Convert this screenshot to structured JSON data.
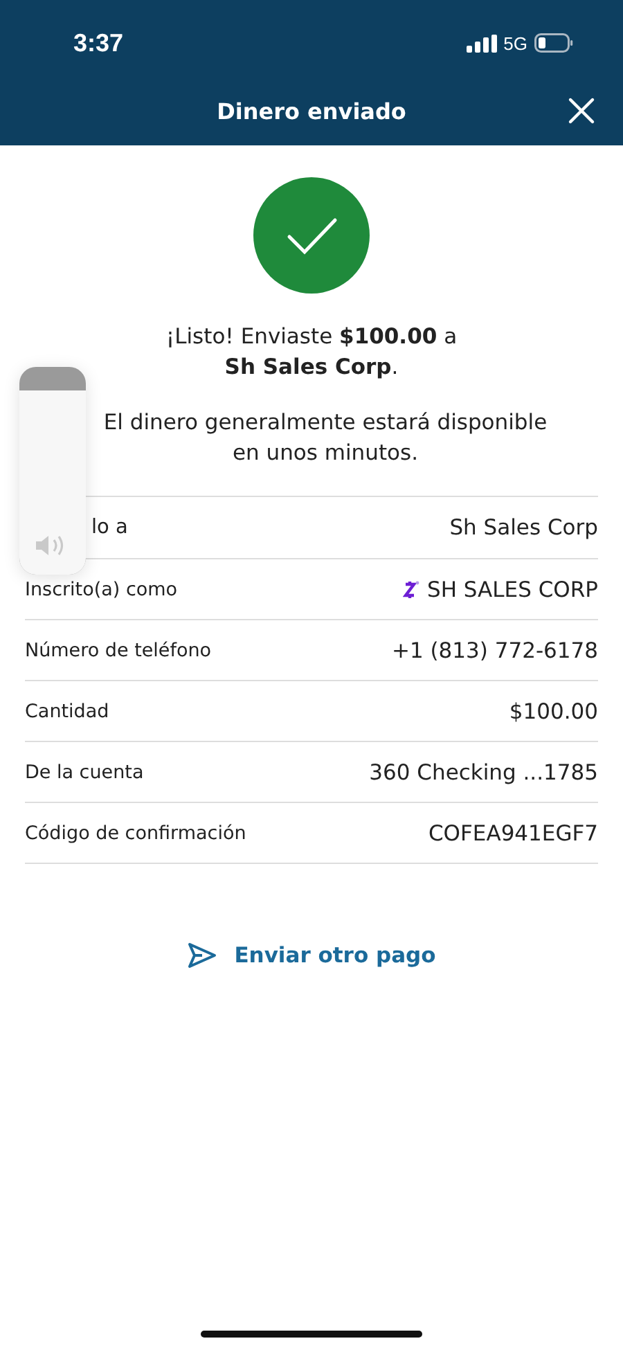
{
  "status_bar": {
    "time": "3:37",
    "network": "5G"
  },
  "header": {
    "title": "Dinero enviado"
  },
  "confirmation": {
    "message": "¡Listo! Enviaste **$100.00** a\n**Sh Sales Corp**.",
    "note": "El dinero generalmente estará disponible\nen unos minutos."
  },
  "details": [
    {
      "label": "lo a",
      "value": "Sh Sales Corp",
      "brand_icon": false
    },
    {
      "label": "Inscrito(a) como",
      "value": "SH SALES CORP",
      "brand_icon": true
    },
    {
      "label": "Número de teléfono",
      "value": "+1 (813) 772-6178",
      "brand_icon": false
    },
    {
      "label": "Cantidad",
      "value": "$100.00",
      "brand_icon": false
    },
    {
      "label": "De la cuenta",
      "value": "360 Checking ...1785",
      "brand_icon": false
    },
    {
      "label": "Código de confirmación",
      "value": "COFEA941EGF7",
      "brand_icon": false
    }
  ],
  "action": {
    "label": "Enviar otro pago"
  },
  "volume": {
    "level": 0.89
  }
}
